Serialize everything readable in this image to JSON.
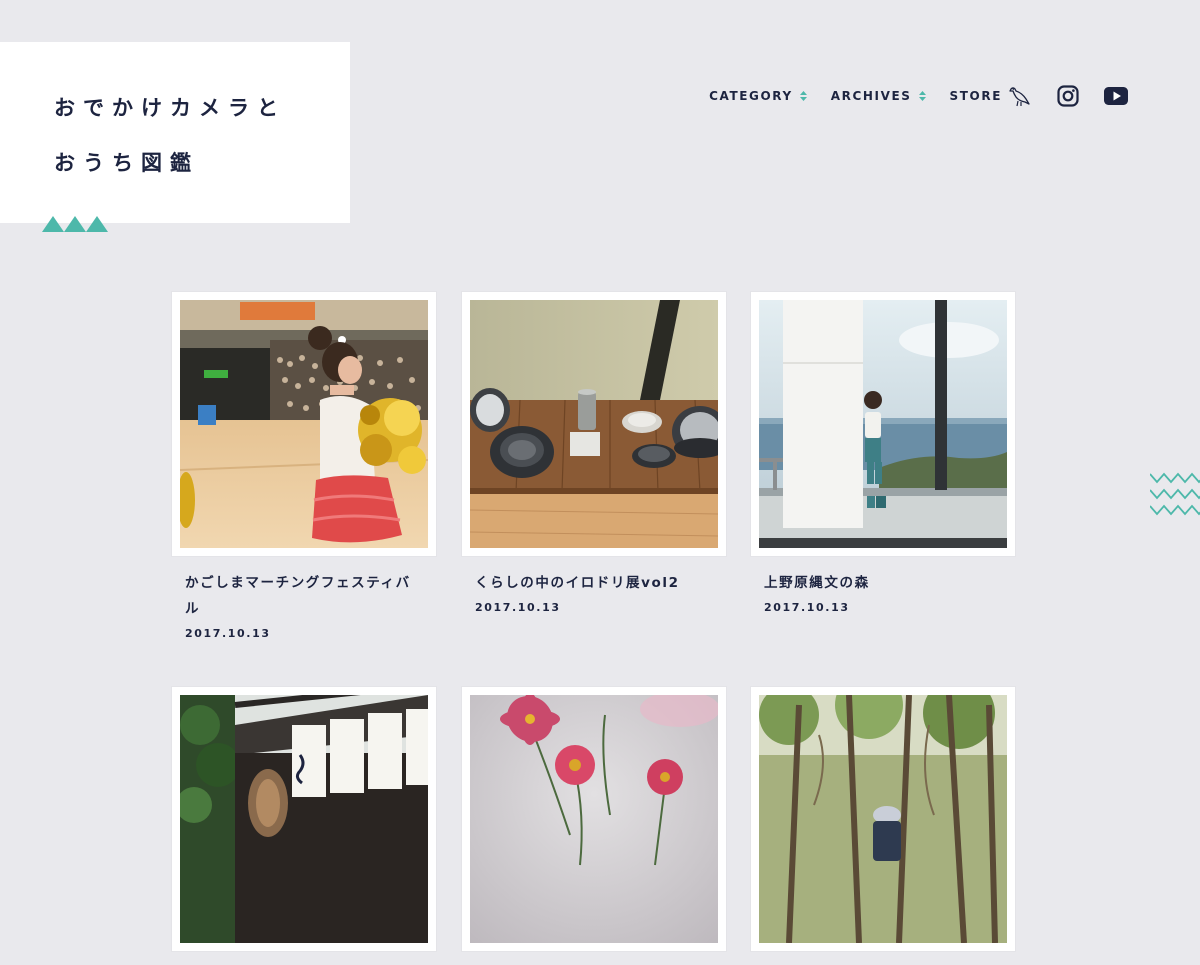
{
  "site": {
    "title_line1": "おでかけカメラと",
    "title_line2": "おうち図鑑"
  },
  "nav": {
    "category_label": "CATEGORY",
    "archives_label": "ARCHIVES",
    "store_label": "STORE",
    "icons": [
      "arrows-icon",
      "bird-icon",
      "instagram-icon",
      "youtube-icon"
    ]
  },
  "colors": {
    "background": "#e9e9ed",
    "navy": "#1d2440",
    "accent_teal": "#4db8aa",
    "card_white": "#ffffff"
  },
  "posts": [
    {
      "title": "かごしまマーチングフェスティバル",
      "date": "2017.10.13"
    },
    {
      "title": "くらしの中のイロドリ展vol2",
      "date": "2017.10.13"
    },
    {
      "title": "上野原縄文の森",
      "date": "2017.10.13"
    },
    {
      "title": "",
      "date": ""
    },
    {
      "title": "",
      "date": ""
    },
    {
      "title": "",
      "date": ""
    }
  ]
}
